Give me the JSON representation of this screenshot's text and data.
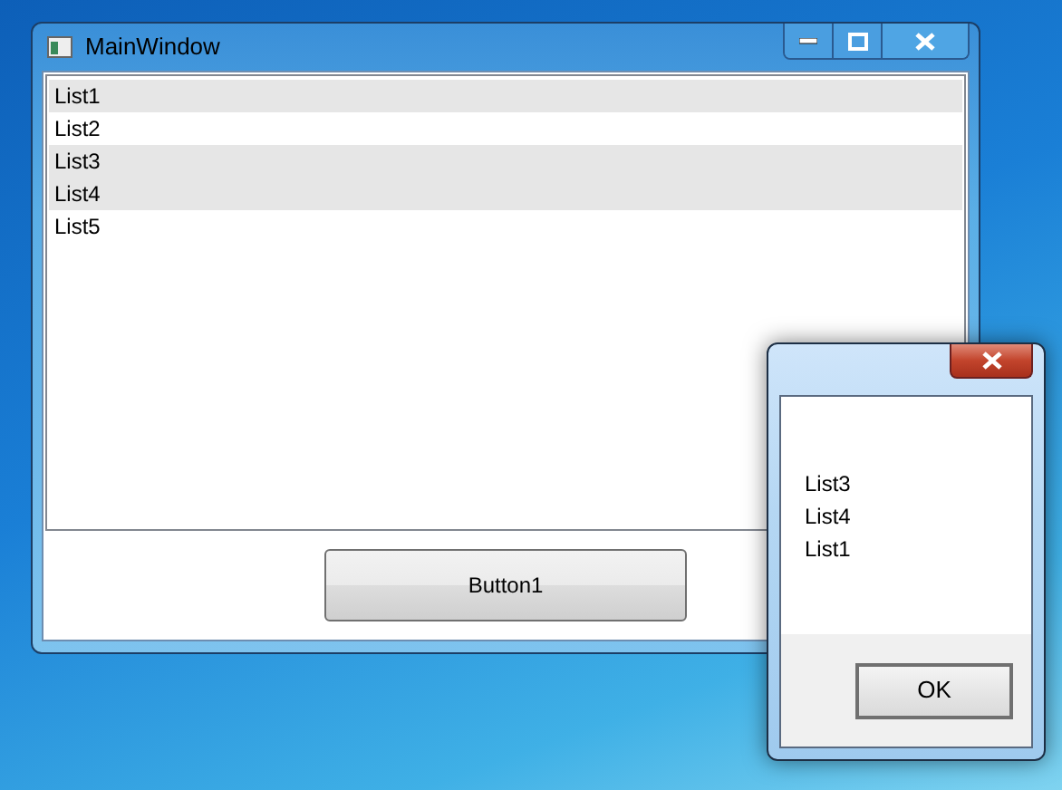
{
  "main_window": {
    "title": "MainWindow",
    "list": [
      {
        "label": "List1",
        "selected": true
      },
      {
        "label": "List2",
        "selected": false
      },
      {
        "label": "List3",
        "selected": true
      },
      {
        "label": "List4",
        "selected": true
      },
      {
        "label": "List5",
        "selected": false
      }
    ],
    "button": "Button1"
  },
  "dialog": {
    "lines": [
      "List3",
      "List4",
      "List1"
    ],
    "button": "OK"
  }
}
